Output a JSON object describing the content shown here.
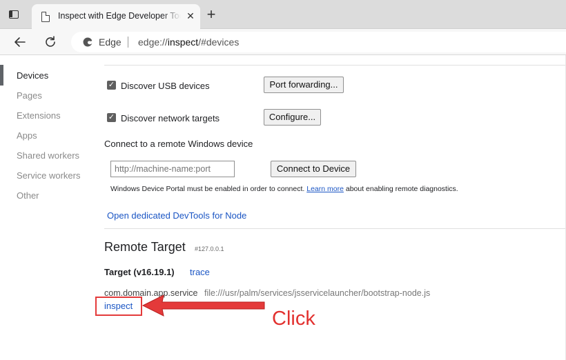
{
  "browser": {
    "tab": {
      "title": "Inspect with Edge Developer Tools"
    },
    "address_bar": {
      "site_label": "Edge",
      "url_scheme": "edge://",
      "url_host": "inspect",
      "url_path": "/#devices"
    },
    "icons": [
      "tab-actions-icon",
      "document-icon",
      "close-icon",
      "plus-icon",
      "back-arrow-icon",
      "refresh-icon",
      "edge-logo-icon"
    ]
  },
  "sidebar": {
    "items": [
      {
        "label": "Devices",
        "selected": true
      },
      {
        "label": "Pages"
      },
      {
        "label": "Extensions"
      },
      {
        "label": "Apps"
      },
      {
        "label": "Shared workers"
      },
      {
        "label": "Service workers"
      },
      {
        "label": "Other"
      }
    ]
  },
  "devices": {
    "usb": {
      "label": "Discover USB devices",
      "checked": true,
      "button": "Port forwarding..."
    },
    "network": {
      "label": "Discover network targets",
      "checked": true,
      "button": "Configure..."
    },
    "remote_windows": {
      "heading": "Connect to a remote Windows device",
      "input_placeholder": "http://machine-name:port",
      "button": "Connect to Device",
      "notice_before": "Windows Device Portal must be enabled in order to connect.",
      "notice_link": "Learn more",
      "notice_after": "about enabling remote diagnostics."
    },
    "node_link": "Open dedicated DevTools for Node"
  },
  "remote_target": {
    "title": "Remote Target",
    "address": "#127.0.0.1",
    "target_name": "Target (v16.19.1)",
    "trace_link": "trace",
    "package": "com.domain.app.service",
    "path": "file:///usr/palm/services/jsservicelauncher/bootstrap-node.js",
    "inspect_link": "inspect"
  },
  "annotation": {
    "label": "Click",
    "color": "#e2312f"
  },
  "colors": {
    "link": "#1a55c4",
    "highlight": "#e43a3a"
  }
}
